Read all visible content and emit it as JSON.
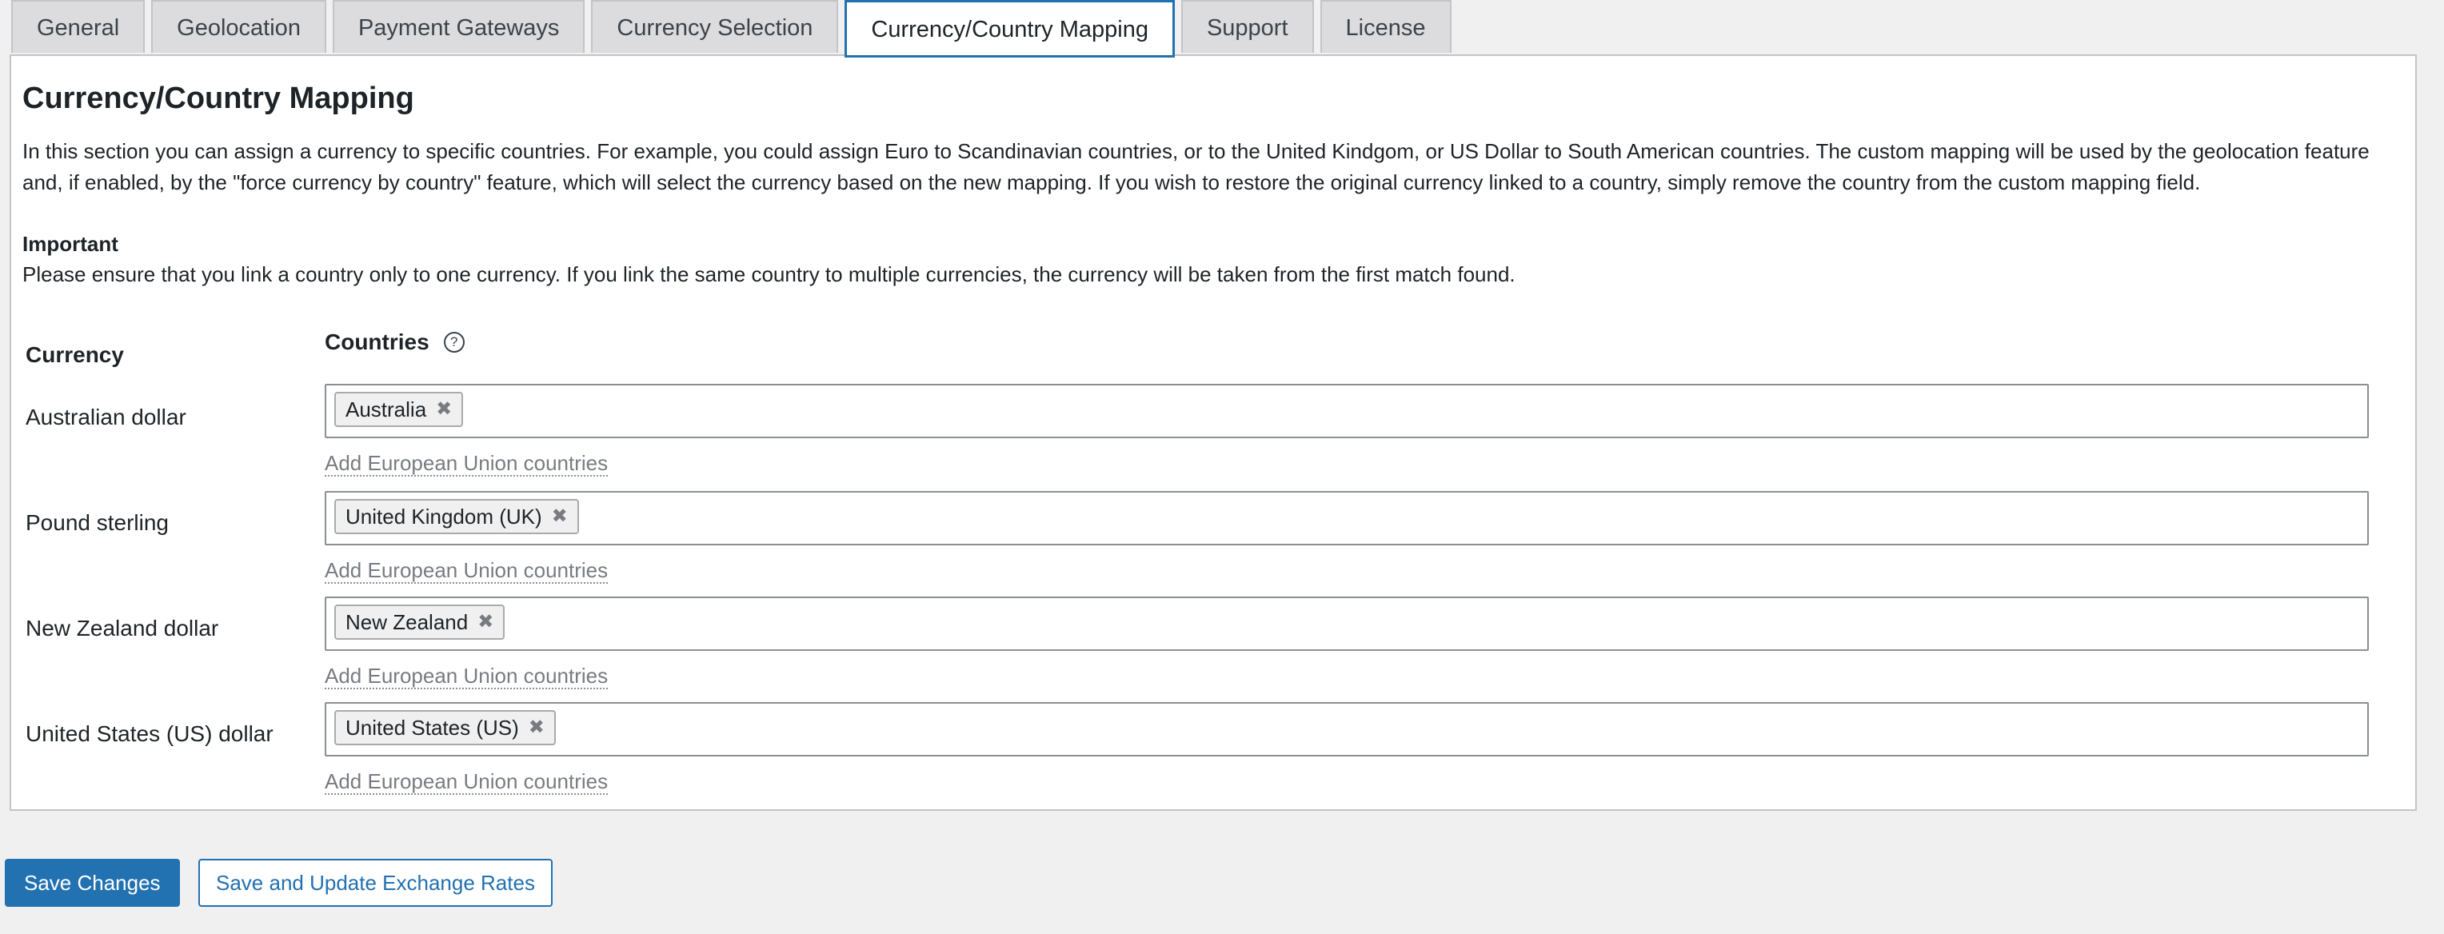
{
  "tabs": [
    {
      "label": "General"
    },
    {
      "label": "Geolocation"
    },
    {
      "label": "Payment Gateways"
    },
    {
      "label": "Currency Selection"
    },
    {
      "label": "Currency/Country Mapping"
    },
    {
      "label": "Support"
    },
    {
      "label": "License"
    }
  ],
  "active_tab": "Currency/Country Mapping",
  "section": {
    "title": "Currency/Country Mapping",
    "intro": "In this section you can assign a currency to specific countries. For example, you could assign Euro to Scandinavian countries, or to the United Kindgom, or US Dollar to South American countries. The custom mapping will be used by the geolocation feature and, if enabled, by the \"force currency by country\" feature, which will select the currency based on the new mapping. If you wish to restore the original currency linked to a country, simply remove the country from the custom mapping field.",
    "important_heading": "Important",
    "important_text": "Please ensure that you link a country only to one currency. If you link the same country to multiple currencies, the currency will be taken from the first match found."
  },
  "table": {
    "currency_header": "Currency",
    "countries_header": "Countries",
    "help_icon": "?",
    "rows": [
      {
        "currency": "Australian dollar",
        "countries": [
          "Australia"
        ],
        "eu_link": "Add European Union countries"
      },
      {
        "currency": "Pound sterling",
        "countries": [
          "United Kingdom (UK)"
        ],
        "eu_link": "Add European Union countries"
      },
      {
        "currency": "New Zealand dollar",
        "countries": [
          "New Zealand"
        ],
        "eu_link": "Add European Union countries"
      },
      {
        "currency": "United States (US) dollar",
        "countries": [
          "United States (US)"
        ],
        "eu_link": "Add European Union countries"
      }
    ],
    "remove_glyph": "✖"
  },
  "buttons": {
    "save": "Save Changes",
    "save_update": "Save and Update Exchange Rates"
  },
  "colors": {
    "accent": "#2271b1",
    "page_bg": "#f0f0f1",
    "text": "#1d2327"
  }
}
